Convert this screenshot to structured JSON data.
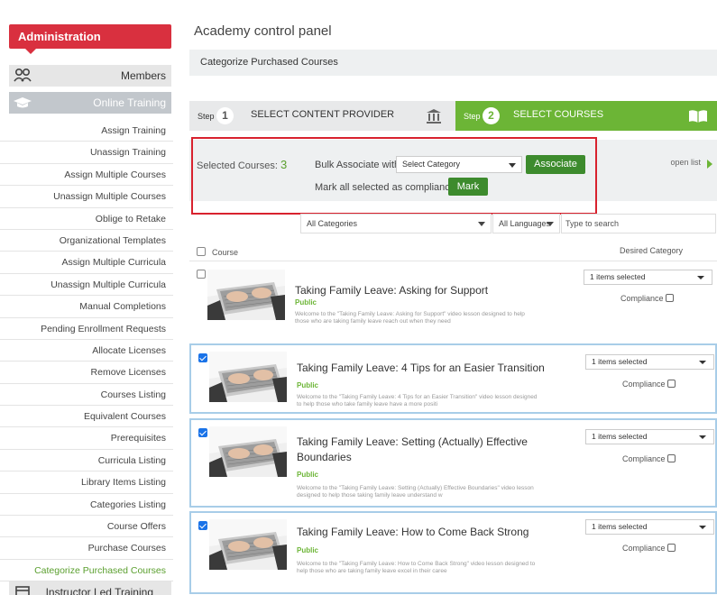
{
  "sidebar": {
    "admin_label": "Administration",
    "members_label": "Members",
    "online_training_label": "Online Training",
    "items": [
      "Assign Training",
      "Unassign Training",
      "Assign Multiple Courses",
      "Unassign Multiple Courses",
      "Oblige to Retake",
      "Organizational Templates",
      "Assign Multiple Curricula",
      "Unassign Multiple Curricula",
      "Manual Completions",
      "Pending Enrollment Requests",
      "Allocate Licenses",
      "Remove Licenses",
      "Courses Listing",
      "Equivalent Courses",
      "Prerequisites",
      "Curricula Listing",
      "Library Items Listing",
      "Categories Listing",
      "Course Offers",
      "Purchase Courses",
      "Categorize Purchased Courses"
    ],
    "instructor_led_label": "Instructor Led Training"
  },
  "page": {
    "title": "Academy control panel",
    "breadcrumb": "Categorize Purchased Courses"
  },
  "steps": {
    "step_word": "Step",
    "step1_num": "1",
    "step1_title": "SELECT CONTENT PROVIDER",
    "step2_num": "2",
    "step2_title": "SELECT COURSES"
  },
  "bulk": {
    "selected_label": "Selected Courses:",
    "selected_count": "3",
    "bulk_label": "Bulk Associate with",
    "category_select": "Select Category",
    "associate_button": "Associate",
    "mark_label": "Mark all selected as compliance",
    "mark_button": "Mark",
    "open_list": "open list"
  },
  "filters": {
    "categories": "All Categories",
    "languages": "All Languages",
    "search_placeholder": "Type to search"
  },
  "table": {
    "col_course": "Course",
    "col_category": "Desired Category"
  },
  "courses": [
    {
      "title": "Taking Family Leave: Asking for Support",
      "badge": "Public",
      "desc": "Welcome to the \"Taking Family Leave: Asking for Support\" video lesson designed to help those who are taking family leave reach out when they need",
      "category": "1 items selected",
      "compliance": "Compliance",
      "checked": false
    },
    {
      "title": "Taking Family Leave: 4 Tips for an Easier Transition",
      "badge": "Public",
      "desc": "Welcome to the \"Taking Family Leave: 4 Tips for an Easier Transition\" video lesson designed to help those who take family leave have a more positi",
      "category": "1 items selected",
      "compliance": "Compliance",
      "checked": true
    },
    {
      "title": "Taking Family Leave: Setting (Actually) Effective Boundaries",
      "badge": "Public",
      "desc": "Welcome to the \"Taking Family Leave: Setting (Actually) Effective Boundaries\" video lesson designed to help those taking family leave understand w",
      "category": "1 items selected",
      "compliance": "Compliance",
      "checked": true
    },
    {
      "title": "Taking Family Leave: How to Come Back Strong",
      "badge": "Public",
      "desc": "Welcome to the \"Taking Family Leave: How to Come Back Strong\" video lesson designed to help those who are taking family leave excel in their caree",
      "category": "1 items selected",
      "compliance": "Compliance",
      "checked": true
    }
  ]
}
